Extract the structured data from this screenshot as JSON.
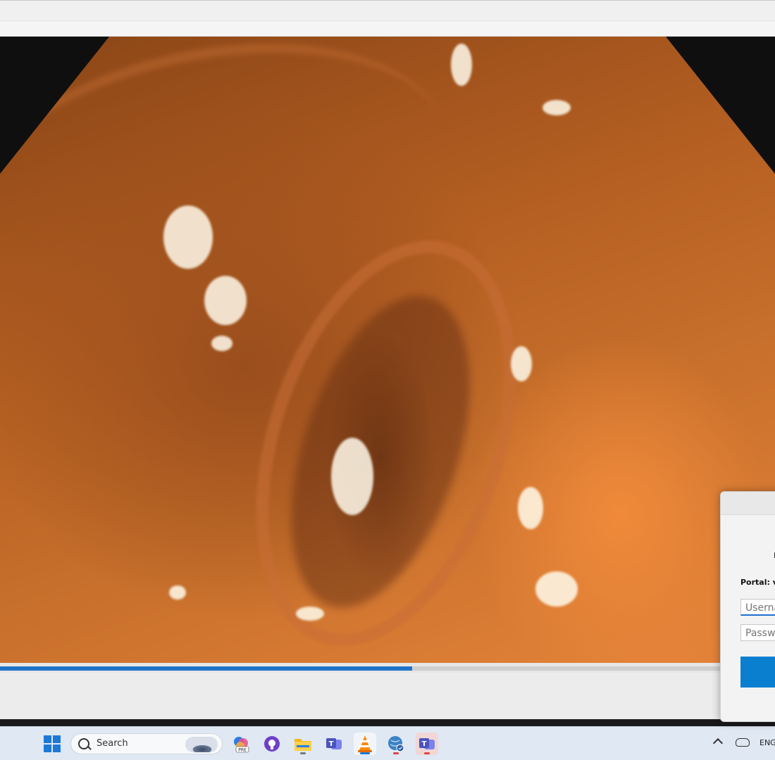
{
  "video": {
    "progress": 0.532,
    "accent_color": "#1f74c9"
  },
  "taskbar": {
    "search": {
      "label": "Search",
      "icon": "search-icon"
    },
    "apps": [
      {
        "name": "start-icon"
      },
      {
        "name": "copilot-icon",
        "badge": "PRE"
      },
      {
        "name": "github-icon"
      },
      {
        "name": "file-explorer-icon"
      },
      {
        "name": "teams-icon"
      },
      {
        "name": "vlc-icon",
        "active": true
      },
      {
        "name": "globe-vpn-icon"
      },
      {
        "name": "teams-work-icon"
      }
    ],
    "tray": {
      "language": "ENG"
    }
  },
  "vpn_dialog": {
    "portal_label": "Portal: vp",
    "username_placeholder": "Userna",
    "password_placeholder": "Passwo"
  }
}
